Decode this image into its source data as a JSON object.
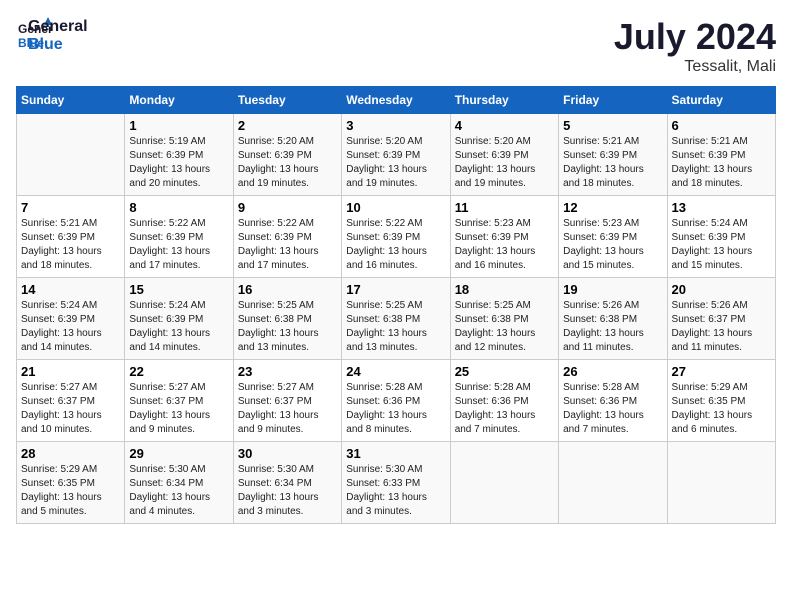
{
  "header": {
    "logo_line1": "General",
    "logo_line2": "Blue",
    "month_title": "July 2024",
    "location": "Tessalit, Mali"
  },
  "days_of_week": [
    "Sunday",
    "Monday",
    "Tuesday",
    "Wednesday",
    "Thursday",
    "Friday",
    "Saturday"
  ],
  "weeks": [
    [
      {
        "day": "",
        "sunrise": "",
        "sunset": "",
        "daylight": ""
      },
      {
        "day": "1",
        "sunrise": "Sunrise: 5:19 AM",
        "sunset": "Sunset: 6:39 PM",
        "daylight": "Daylight: 13 hours and 20 minutes."
      },
      {
        "day": "2",
        "sunrise": "Sunrise: 5:20 AM",
        "sunset": "Sunset: 6:39 PM",
        "daylight": "Daylight: 13 hours and 19 minutes."
      },
      {
        "day": "3",
        "sunrise": "Sunrise: 5:20 AM",
        "sunset": "Sunset: 6:39 PM",
        "daylight": "Daylight: 13 hours and 19 minutes."
      },
      {
        "day": "4",
        "sunrise": "Sunrise: 5:20 AM",
        "sunset": "Sunset: 6:39 PM",
        "daylight": "Daylight: 13 hours and 19 minutes."
      },
      {
        "day": "5",
        "sunrise": "Sunrise: 5:21 AM",
        "sunset": "Sunset: 6:39 PM",
        "daylight": "Daylight: 13 hours and 18 minutes."
      },
      {
        "day": "6",
        "sunrise": "Sunrise: 5:21 AM",
        "sunset": "Sunset: 6:39 PM",
        "daylight": "Daylight: 13 hours and 18 minutes."
      }
    ],
    [
      {
        "day": "7",
        "sunrise": "Sunrise: 5:21 AM",
        "sunset": "Sunset: 6:39 PM",
        "daylight": "Daylight: 13 hours and 18 minutes."
      },
      {
        "day": "8",
        "sunrise": "Sunrise: 5:22 AM",
        "sunset": "Sunset: 6:39 PM",
        "daylight": "Daylight: 13 hours and 17 minutes."
      },
      {
        "day": "9",
        "sunrise": "Sunrise: 5:22 AM",
        "sunset": "Sunset: 6:39 PM",
        "daylight": "Daylight: 13 hours and 17 minutes."
      },
      {
        "day": "10",
        "sunrise": "Sunrise: 5:22 AM",
        "sunset": "Sunset: 6:39 PM",
        "daylight": "Daylight: 13 hours and 16 minutes."
      },
      {
        "day": "11",
        "sunrise": "Sunrise: 5:23 AM",
        "sunset": "Sunset: 6:39 PM",
        "daylight": "Daylight: 13 hours and 16 minutes."
      },
      {
        "day": "12",
        "sunrise": "Sunrise: 5:23 AM",
        "sunset": "Sunset: 6:39 PM",
        "daylight": "Daylight: 13 hours and 15 minutes."
      },
      {
        "day": "13",
        "sunrise": "Sunrise: 5:24 AM",
        "sunset": "Sunset: 6:39 PM",
        "daylight": "Daylight: 13 hours and 15 minutes."
      }
    ],
    [
      {
        "day": "14",
        "sunrise": "Sunrise: 5:24 AM",
        "sunset": "Sunset: 6:39 PM",
        "daylight": "Daylight: 13 hours and 14 minutes."
      },
      {
        "day": "15",
        "sunrise": "Sunrise: 5:24 AM",
        "sunset": "Sunset: 6:39 PM",
        "daylight": "Daylight: 13 hours and 14 minutes."
      },
      {
        "day": "16",
        "sunrise": "Sunrise: 5:25 AM",
        "sunset": "Sunset: 6:38 PM",
        "daylight": "Daylight: 13 hours and 13 minutes."
      },
      {
        "day": "17",
        "sunrise": "Sunrise: 5:25 AM",
        "sunset": "Sunset: 6:38 PM",
        "daylight": "Daylight: 13 hours and 13 minutes."
      },
      {
        "day": "18",
        "sunrise": "Sunrise: 5:25 AM",
        "sunset": "Sunset: 6:38 PM",
        "daylight": "Daylight: 13 hours and 12 minutes."
      },
      {
        "day": "19",
        "sunrise": "Sunrise: 5:26 AM",
        "sunset": "Sunset: 6:38 PM",
        "daylight": "Daylight: 13 hours and 11 minutes."
      },
      {
        "day": "20",
        "sunrise": "Sunrise: 5:26 AM",
        "sunset": "Sunset: 6:37 PM",
        "daylight": "Daylight: 13 hours and 11 minutes."
      }
    ],
    [
      {
        "day": "21",
        "sunrise": "Sunrise: 5:27 AM",
        "sunset": "Sunset: 6:37 PM",
        "daylight": "Daylight: 13 hours and 10 minutes."
      },
      {
        "day": "22",
        "sunrise": "Sunrise: 5:27 AM",
        "sunset": "Sunset: 6:37 PM",
        "daylight": "Daylight: 13 hours and 9 minutes."
      },
      {
        "day": "23",
        "sunrise": "Sunrise: 5:27 AM",
        "sunset": "Sunset: 6:37 PM",
        "daylight": "Daylight: 13 hours and 9 minutes."
      },
      {
        "day": "24",
        "sunrise": "Sunrise: 5:28 AM",
        "sunset": "Sunset: 6:36 PM",
        "daylight": "Daylight: 13 hours and 8 minutes."
      },
      {
        "day": "25",
        "sunrise": "Sunrise: 5:28 AM",
        "sunset": "Sunset: 6:36 PM",
        "daylight": "Daylight: 13 hours and 7 minutes."
      },
      {
        "day": "26",
        "sunrise": "Sunrise: 5:28 AM",
        "sunset": "Sunset: 6:36 PM",
        "daylight": "Daylight: 13 hours and 7 minutes."
      },
      {
        "day": "27",
        "sunrise": "Sunrise: 5:29 AM",
        "sunset": "Sunset: 6:35 PM",
        "daylight": "Daylight: 13 hours and 6 minutes."
      }
    ],
    [
      {
        "day": "28",
        "sunrise": "Sunrise: 5:29 AM",
        "sunset": "Sunset: 6:35 PM",
        "daylight": "Daylight: 13 hours and 5 minutes."
      },
      {
        "day": "29",
        "sunrise": "Sunrise: 5:30 AM",
        "sunset": "Sunset: 6:34 PM",
        "daylight": "Daylight: 13 hours and 4 minutes."
      },
      {
        "day": "30",
        "sunrise": "Sunrise: 5:30 AM",
        "sunset": "Sunset: 6:34 PM",
        "daylight": "Daylight: 13 hours and 3 minutes."
      },
      {
        "day": "31",
        "sunrise": "Sunrise: 5:30 AM",
        "sunset": "Sunset: 6:33 PM",
        "daylight": "Daylight: 13 hours and 3 minutes."
      },
      {
        "day": "",
        "sunrise": "",
        "sunset": "",
        "daylight": ""
      },
      {
        "day": "",
        "sunrise": "",
        "sunset": "",
        "daylight": ""
      },
      {
        "day": "",
        "sunrise": "",
        "sunset": "",
        "daylight": ""
      }
    ]
  ]
}
